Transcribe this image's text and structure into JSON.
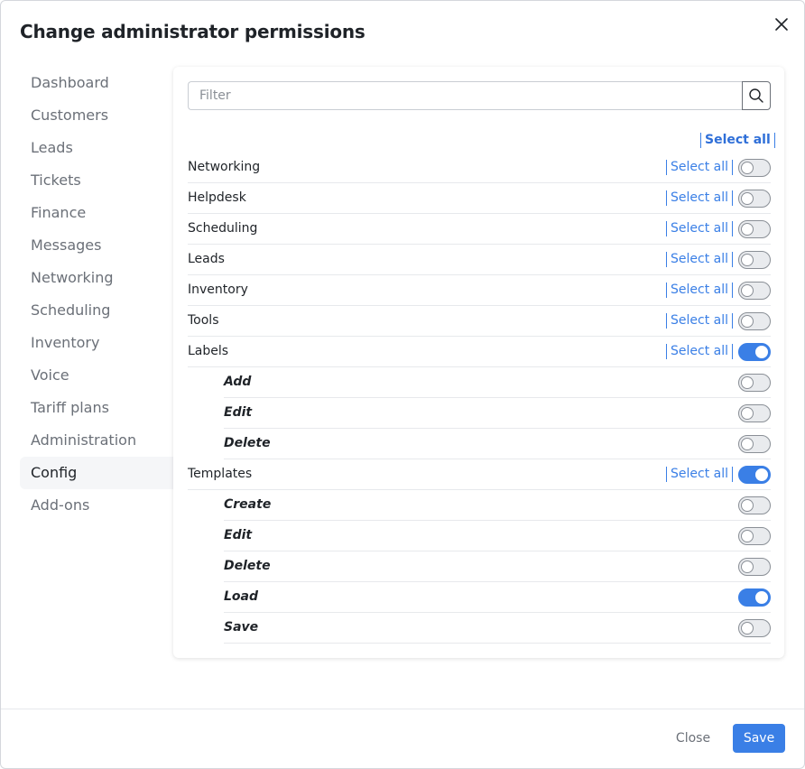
{
  "dialog": {
    "title": "Change administrator permissions"
  },
  "nav": {
    "items": [
      {
        "label": "Dashboard",
        "active": false
      },
      {
        "label": "Customers",
        "active": false
      },
      {
        "label": "Leads",
        "active": false
      },
      {
        "label": "Tickets",
        "active": false
      },
      {
        "label": "Finance",
        "active": false
      },
      {
        "label": "Messages",
        "active": false
      },
      {
        "label": "Networking",
        "active": false
      },
      {
        "label": "Scheduling",
        "active": false
      },
      {
        "label": "Inventory",
        "active": false
      },
      {
        "label": "Voice",
        "active": false
      },
      {
        "label": "Tariff plans",
        "active": false
      },
      {
        "label": "Administration",
        "active": false
      },
      {
        "label": "Config",
        "active": true
      },
      {
        "label": "Add-ons",
        "active": false
      }
    ]
  },
  "filter": {
    "placeholder": "Filter",
    "value": "",
    "icon": "search-icon"
  },
  "select_all_label": "Select all",
  "permissions": [
    {
      "label": "Networking",
      "level": "group",
      "select_all": "Select all",
      "enabled": false
    },
    {
      "label": "Helpdesk",
      "level": "group",
      "select_all": "Select all",
      "enabled": false
    },
    {
      "label": "Scheduling",
      "level": "group",
      "select_all": "Select all",
      "enabled": false
    },
    {
      "label": "Leads",
      "level": "group",
      "select_all": "Select all",
      "enabled": false
    },
    {
      "label": "Inventory",
      "level": "group",
      "select_all": "Select all",
      "enabled": false
    },
    {
      "label": "Tools",
      "level": "group",
      "select_all": "Select all",
      "enabled": false
    },
    {
      "label": "Labels",
      "level": "group",
      "select_all": "Select all",
      "enabled": true
    },
    {
      "label": "Add",
      "level": "sub",
      "enabled": false
    },
    {
      "label": "Edit",
      "level": "sub",
      "enabled": false
    },
    {
      "label": "Delete",
      "level": "sub",
      "enabled": false
    },
    {
      "label": "Templates",
      "level": "group",
      "select_all": "Select all",
      "enabled": true
    },
    {
      "label": "Create",
      "level": "sub",
      "enabled": false
    },
    {
      "label": "Edit",
      "level": "sub",
      "enabled": false
    },
    {
      "label": "Delete",
      "level": "sub",
      "enabled": false
    },
    {
      "label": "Load",
      "level": "sub",
      "enabled": true
    },
    {
      "label": "Save",
      "level": "sub",
      "enabled": false
    }
  ],
  "footer": {
    "close_label": "Close",
    "save_label": "Save"
  },
  "colors": {
    "accent": "#3a7fe6",
    "text": "#1f2328",
    "muted": "#6b7078"
  }
}
